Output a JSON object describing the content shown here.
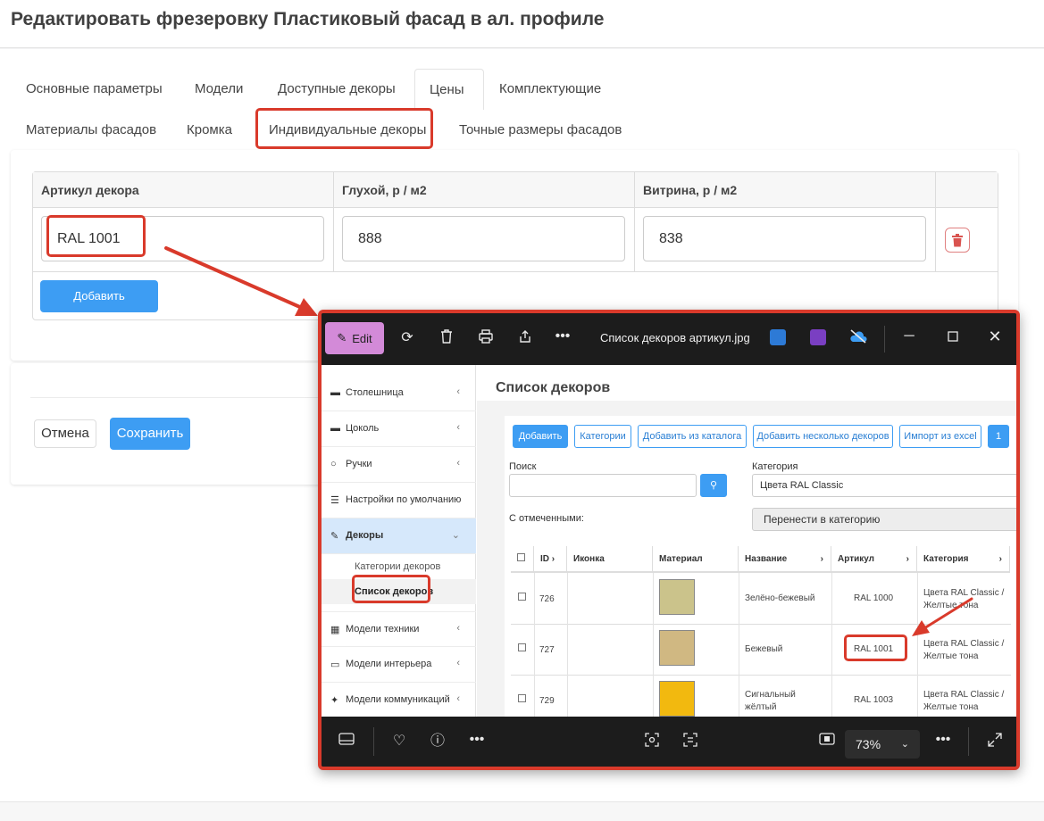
{
  "page": {
    "title": "Редактировать фрезеровку Пластиковый фасад в ал. профиле"
  },
  "tabs": [
    {
      "label": "Основные параметры"
    },
    {
      "label": "Модели"
    },
    {
      "label": "Доступные декоры"
    },
    {
      "label": "Цены"
    },
    {
      "label": "Комплектующие"
    },
    {
      "label": "Материалы фасадов"
    },
    {
      "label": "Кромка"
    },
    {
      "label": "Индивидуальные декоры"
    },
    {
      "label": "Точные размеры фасадов"
    }
  ],
  "decor_table": {
    "headers": [
      "Артикул декора",
      "Глухой, р / м2",
      "Витрина, р / м2"
    ],
    "row": {
      "article": "RAL 1001",
      "solid_price": "888",
      "glass_price": "838"
    },
    "add_label": "Добавить"
  },
  "form_actions": {
    "cancel_label": "Отмена",
    "save_label": "Сохранить"
  },
  "viewer": {
    "edit_label": "Edit",
    "file_name": "Список декоров артикул.jpg",
    "zoom": "73%",
    "screenshot": {
      "sidebar": [
        {
          "label": "Столешница"
        },
        {
          "label": "Цоколь"
        },
        {
          "label": "Ручки"
        },
        {
          "label": "Настройки по умолчанию"
        },
        {
          "label": "Декоры"
        },
        {
          "label": "Модели техники"
        },
        {
          "label": "Модели интерьера"
        },
        {
          "label": "Модели коммуникаций"
        }
      ],
      "sidebar_sub": [
        "Категории декоров",
        "Список декоров"
      ],
      "title": "Список декоров",
      "buttons": [
        "Добавить",
        "Категории",
        "Добавить из каталога",
        "Добавить несколько декоров",
        "Импорт из excel",
        "1"
      ],
      "search_label": "Поиск",
      "category_label": "Категория",
      "category_value": "Цвета RAL Classic",
      "marked_label": "С отмеченными:",
      "move_label": "Перенести в категорию",
      "columns": [
        "ID",
        "Иконка",
        "Материал",
        "Название",
        "Артикул",
        "Категория"
      ],
      "rows": [
        {
          "id": "726",
          "name": "Зелёно-бежевый",
          "article": "RAL 1000",
          "category": "Цвета RAL Classic / Желтые тона",
          "color": "#cbc38b"
        },
        {
          "id": "727",
          "name": "Бежевый",
          "article": "RAL 1001",
          "category": "Цвета RAL Classic / Желтые тона",
          "color": "#d0b882"
        },
        {
          "id": "729",
          "name": "Сигнальный жёлтый",
          "article": "RAL 1003",
          "category": "Цвета RAL Classic / Желтые тона",
          "color": "#f2b90f"
        }
      ]
    }
  }
}
